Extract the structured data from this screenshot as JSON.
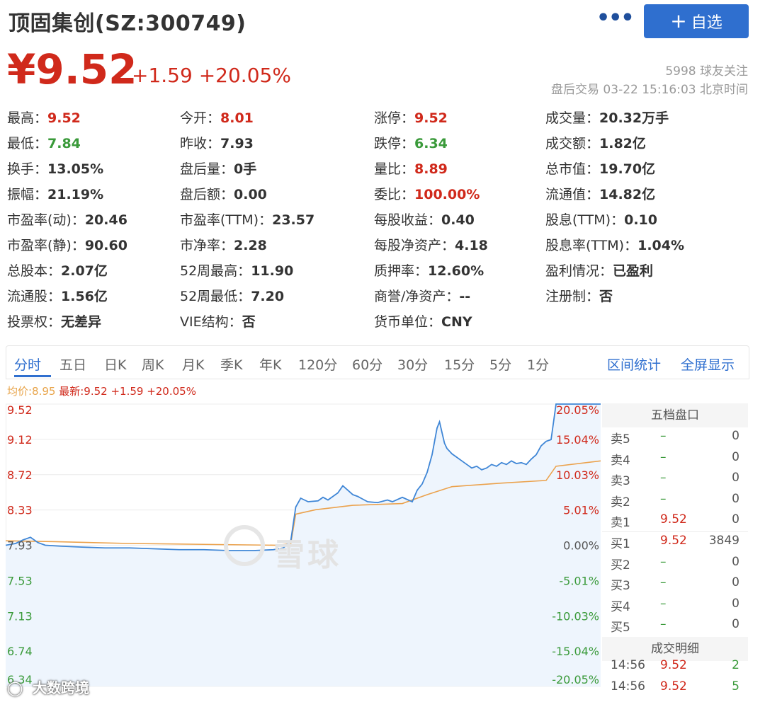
{
  "header": {
    "title": "顶固集创(SZ:300749)",
    "more_label": "•••",
    "add_label": "自选",
    "price": "¥9.52",
    "change": "+1.59  +20.05%",
    "followers": "5998 球友关注",
    "trade_time": "盘后交易 03-22 15:16:03 北京时间"
  },
  "stats": [
    {
      "label": "最高：",
      "value": "9.52",
      "color": "red"
    },
    {
      "label": "今开：",
      "value": "8.01",
      "color": "red"
    },
    {
      "label": "涨停：",
      "value": "9.52",
      "color": "red"
    },
    {
      "label": "成交量：",
      "value": "20.32万手",
      "color": ""
    },
    {
      "label": "最低：",
      "value": "7.84",
      "color": "green"
    },
    {
      "label": "昨收：",
      "value": "7.93",
      "color": ""
    },
    {
      "label": "跌停：",
      "value": "6.34",
      "color": "green"
    },
    {
      "label": "成交额：",
      "value": "1.82亿",
      "color": ""
    },
    {
      "label": "换手：",
      "value": "13.05%",
      "color": ""
    },
    {
      "label": "盘后量：",
      "value": "0手",
      "color": ""
    },
    {
      "label": "量比：",
      "value": "8.89",
      "color": "red"
    },
    {
      "label": "总市值：",
      "value": "19.70亿",
      "color": ""
    },
    {
      "label": "振幅：",
      "value": "21.19%",
      "color": ""
    },
    {
      "label": "盘后额：",
      "value": "0.00",
      "color": ""
    },
    {
      "label": "委比：",
      "value": "100.00%",
      "color": "red"
    },
    {
      "label": "流通值：",
      "value": "14.82亿",
      "color": ""
    },
    {
      "label": "市盈率(动)：",
      "value": "20.46",
      "color": ""
    },
    {
      "label": "市盈率(TTM)：",
      "value": "23.57",
      "color": ""
    },
    {
      "label": "每股收益：",
      "value": "0.40",
      "color": ""
    },
    {
      "label": "股息(TTM)：",
      "value": "0.10",
      "color": ""
    },
    {
      "label": "市盈率(静)：",
      "value": "90.60",
      "color": ""
    },
    {
      "label": "市净率：",
      "value": "2.28",
      "color": ""
    },
    {
      "label": "每股净资产：",
      "value": "4.18",
      "color": ""
    },
    {
      "label": "股息率(TTM)：",
      "value": "1.04%",
      "color": ""
    },
    {
      "label": "总股本：",
      "value": "2.07亿",
      "color": ""
    },
    {
      "label": "52周最高：",
      "value": "11.90",
      "color": ""
    },
    {
      "label": "质押率：",
      "value": "12.60%",
      "color": ""
    },
    {
      "label": "盈利情况：",
      "value": "已盈利",
      "color": ""
    },
    {
      "label": "流通股：",
      "value": "1.56亿",
      "color": ""
    },
    {
      "label": "52周最低：",
      "value": "7.20",
      "color": ""
    },
    {
      "label": "商誉/净资产：",
      "value": "--",
      "color": ""
    },
    {
      "label": "注册制：",
      "value": "否",
      "color": ""
    },
    {
      "label": "投票权：",
      "value": "无差异",
      "color": ""
    },
    {
      "label": "VIE结构：",
      "value": "否",
      "color": ""
    },
    {
      "label": "货币单位：",
      "value": "CNY",
      "color": ""
    }
  ],
  "tabs": [
    "分时",
    "五日",
    "日K",
    "周K",
    "月K",
    "季K",
    "年K",
    "120分",
    "60分",
    "30分",
    "15分",
    "5分",
    "1分"
  ],
  "right_tabs": [
    "区间统计",
    "全屏显示"
  ],
  "legend": {
    "avg": "均价:8.95",
    "last": "最新:9.52 +1.59 +20.05%"
  },
  "chart_data": {
    "type": "line",
    "left_ticks": [
      {
        "text": "9.52",
        "color": "red"
      },
      {
        "text": "9.12",
        "color": "red"
      },
      {
        "text": "8.72",
        "color": "red"
      },
      {
        "text": "8.33",
        "color": "red"
      },
      {
        "text": "7.93",
        "color": "gray"
      },
      {
        "text": "7.53",
        "color": "green"
      },
      {
        "text": "7.13",
        "color": "green"
      },
      {
        "text": "6.74",
        "color": "green"
      },
      {
        "text": "6.34",
        "color": "green"
      }
    ],
    "right_ticks": [
      {
        "text": "20.05%",
        "color": "red"
      },
      {
        "text": "15.04%",
        "color": "red"
      },
      {
        "text": "10.03%",
        "color": "red"
      },
      {
        "text": "5.01%",
        "color": "red"
      },
      {
        "text": "0.00%",
        "color": "gray"
      },
      {
        "text": "-5.01%",
        "color": "green"
      },
      {
        "text": "-10.03%",
        "color": "green"
      },
      {
        "text": "-15.04%",
        "color": "green"
      },
      {
        "text": "-20.05%",
        "color": "green"
      }
    ],
    "ylim": [
      6.34,
      9.52
    ],
    "xlim": [
      0,
      240
    ],
    "series": [
      {
        "values": [
          [
            0,
            7.93
          ],
          [
            4,
            7.95
          ],
          [
            7,
            7.99
          ],
          [
            10,
            8.02
          ],
          [
            13,
            7.96
          ],
          [
            16,
            7.93
          ],
          [
            22,
            7.92
          ],
          [
            30,
            7.91
          ],
          [
            40,
            7.9
          ],
          [
            50,
            7.9
          ],
          [
            60,
            7.89
          ],
          [
            70,
            7.88
          ],
          [
            80,
            7.88
          ],
          [
            90,
            7.87
          ],
          [
            100,
            7.87
          ],
          [
            108,
            7.88
          ],
          [
            112,
            7.9
          ],
          [
            115,
            7.98
          ],
          [
            117,
            8.36
          ],
          [
            119,
            8.46
          ],
          [
            122,
            8.42
          ],
          [
            126,
            8.43
          ],
          [
            128,
            8.47
          ],
          [
            130,
            8.44
          ],
          [
            134,
            8.52
          ],
          [
            136,
            8.6
          ],
          [
            138,
            8.55
          ],
          [
            140,
            8.5
          ],
          [
            142,
            8.48
          ],
          [
            144,
            8.45
          ],
          [
            146,
            8.42
          ],
          [
            150,
            8.41
          ],
          [
            154,
            8.44
          ],
          [
            156,
            8.42
          ],
          [
            160,
            8.47
          ],
          [
            164,
            8.42
          ],
          [
            166,
            8.55
          ],
          [
            168,
            8.62
          ],
          [
            170,
            8.75
          ],
          [
            172,
            8.95
          ],
          [
            174,
            9.25
          ],
          [
            175,
            9.32
          ],
          [
            176,
            9.2
          ],
          [
            177,
            9.08
          ],
          [
            178,
            9.02
          ],
          [
            180,
            8.96
          ],
          [
            182,
            8.92
          ],
          [
            184,
            8.88
          ],
          [
            186,
            8.84
          ],
          [
            188,
            8.8
          ],
          [
            190,
            8.82
          ],
          [
            192,
            8.78
          ],
          [
            194,
            8.8
          ],
          [
            196,
            8.84
          ],
          [
            198,
            8.82
          ],
          [
            200,
            8.86
          ],
          [
            202,
            8.84
          ],
          [
            204,
            8.88
          ],
          [
            206,
            8.85
          ],
          [
            208,
            8.86
          ],
          [
            210,
            8.84
          ],
          [
            212,
            8.9
          ],
          [
            214,
            8.95
          ],
          [
            216,
            9.05
          ],
          [
            218,
            9.1
          ],
          [
            220,
            9.12
          ],
          [
            222,
            9.52
          ],
          [
            240,
            9.52
          ]
        ]
      },
      {
        "values": [
          [
            0,
            7.98
          ],
          [
            20,
            7.97
          ],
          [
            50,
            7.95
          ],
          [
            80,
            7.94
          ],
          [
            110,
            7.93
          ],
          [
            115,
            7.95
          ],
          [
            117,
            8.28
          ],
          [
            125,
            8.33
          ],
          [
            140,
            8.38
          ],
          [
            160,
            8.4
          ],
          [
            170,
            8.5
          ],
          [
            180,
            8.59
          ],
          [
            200,
            8.63
          ],
          [
            218,
            8.66
          ],
          [
            222,
            8.82
          ],
          [
            240,
            8.88
          ]
        ]
      }
    ],
    "colors": {
      "price": "#3f86d6",
      "avg": "#eba24d",
      "fill": "#eef5fd",
      "grid": "#ececec"
    }
  },
  "watermark": "雪球",
  "bottom_watermark": "大数跨境",
  "order_book": {
    "title": "五档盘口",
    "rows": [
      {
        "label": "卖5",
        "price": "–",
        "qty": "0",
        "price_color": "green"
      },
      {
        "label": "卖4",
        "price": "–",
        "qty": "0",
        "price_color": "green"
      },
      {
        "label": "卖3",
        "price": "–",
        "qty": "0",
        "price_color": "green"
      },
      {
        "label": "卖2",
        "price": "–",
        "qty": "0",
        "price_color": "green"
      },
      {
        "label": "卖1",
        "price": "9.52",
        "qty": "0",
        "price_color": "red"
      },
      {
        "label": "买1",
        "price": "9.52",
        "qty": "3849",
        "price_color": "red"
      },
      {
        "label": "买2",
        "price": "–",
        "qty": "0",
        "price_color": "green"
      },
      {
        "label": "买3",
        "price": "–",
        "qty": "0",
        "price_color": "green"
      },
      {
        "label": "买4",
        "price": "–",
        "qty": "0",
        "price_color": "green"
      },
      {
        "label": "买5",
        "price": "–",
        "qty": "0",
        "price_color": "green"
      }
    ]
  },
  "trade_detail": {
    "title": "成交明细",
    "rows": [
      {
        "time": "14:56",
        "price": "9.52",
        "qty": "2"
      },
      {
        "time": "14:56",
        "price": "9.52",
        "qty": "5"
      }
    ]
  }
}
